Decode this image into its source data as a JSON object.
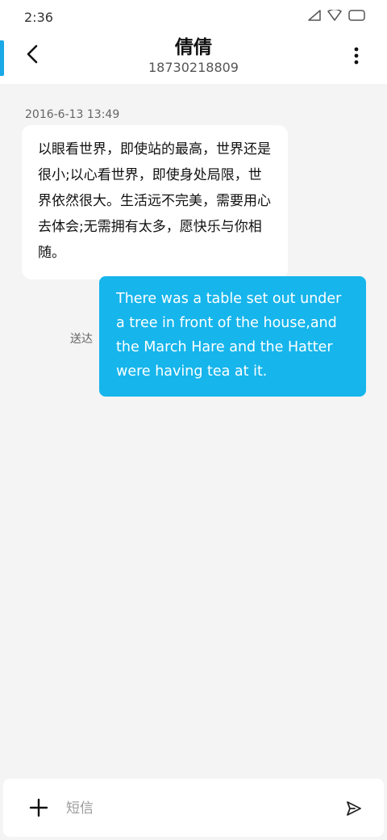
{
  "status_bar": {
    "time": "2:36",
    "icons": [
      "signal-icon",
      "wifi-icon",
      "battery-icon"
    ]
  },
  "header": {
    "contact_name": "倩倩",
    "contact_number": "18730218809",
    "accent_color": "#1aa9e6",
    "back_icon": "chevron-left-icon",
    "more_icon": "more-vertical-icon"
  },
  "conversation": {
    "timestamp": "2016-6-13 13:49",
    "received_message": "以眼看世界，即使站的最高，世界还是很小;以心看世界，即使身处局限，世界依然很大。生活远不完美，需要用心去体会;无需拥有太多，愿快乐与你相随。",
    "sent_message": "There was a table set out under a tree in front of the house,and the March Hare and the Hatter were having tea at it.",
    "sent_status": "送达",
    "sent_bubble_color": "#16b5ec",
    "received_bubble_color": "#ffffff"
  },
  "composer": {
    "placeholder": "短信",
    "add_icon": "plus-icon",
    "send_icon": "send-icon"
  }
}
